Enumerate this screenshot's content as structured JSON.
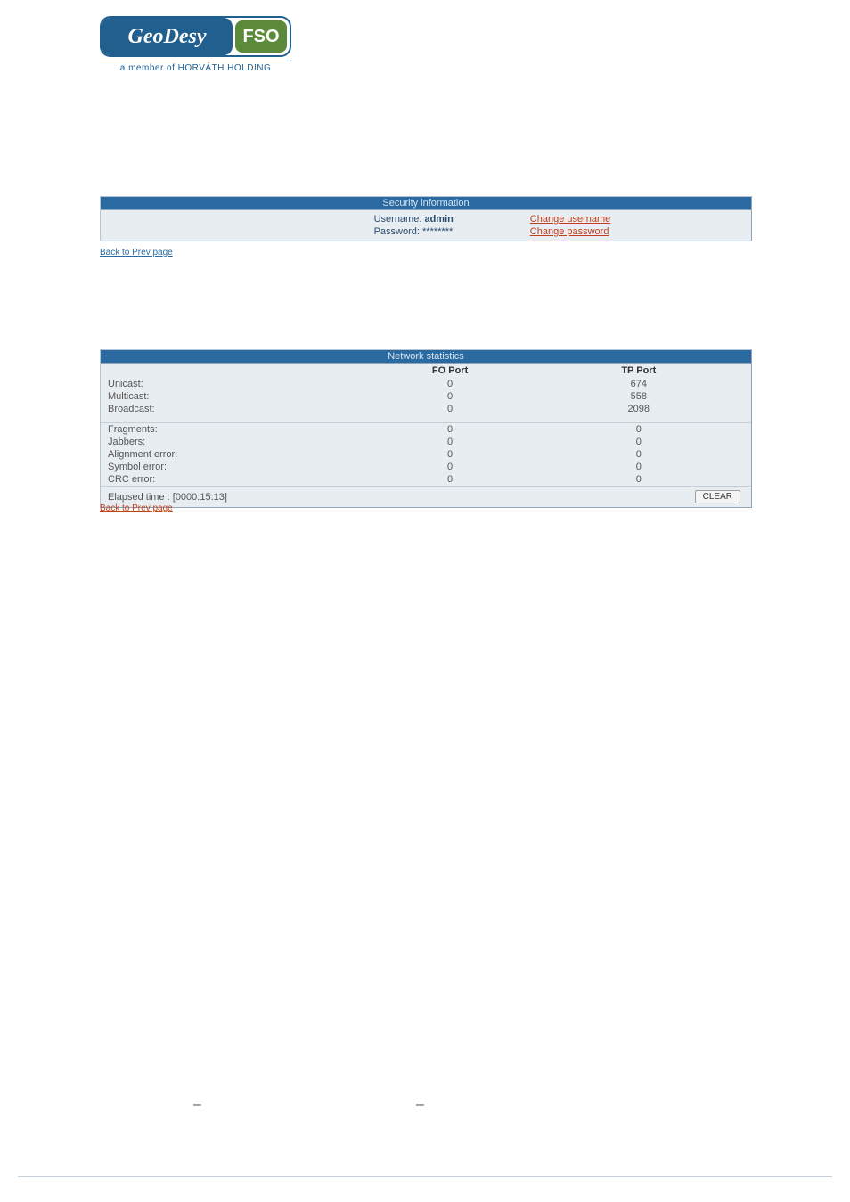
{
  "logo": {
    "main": "GeoDesy",
    "badge": "FSO",
    "sub": "a member of HORVÁTH HOLDING"
  },
  "security_panel": {
    "title": "Security information",
    "username_label": "Username:",
    "username_value": "admin",
    "password_label": "Password:",
    "password_value": "********",
    "change_username": "Change username",
    "change_password": "Change password"
  },
  "back_link": "Back to Prev page",
  "network_panel": {
    "title": "Network statistics",
    "col_fo": "FO Port",
    "col_tp": "TP Port",
    "rows_top": [
      {
        "label": "Unicast:",
        "fo": "0",
        "tp": "674"
      },
      {
        "label": "Multicast:",
        "fo": "0",
        "tp": "558"
      },
      {
        "label": "Broadcast:",
        "fo": "0",
        "tp": "2098"
      }
    ],
    "rows_bottom": [
      {
        "label": "Fragments:",
        "fo": "0",
        "tp": "0"
      },
      {
        "label": "Jabbers:",
        "fo": "0",
        "tp": "0"
      },
      {
        "label": "Alignment error:",
        "fo": "0",
        "tp": "0"
      },
      {
        "label": "Symbol error:",
        "fo": "0",
        "tp": "0"
      },
      {
        "label": "CRC error:",
        "fo": "0",
        "tp": "0"
      }
    ],
    "elapsed": "Elapsed time : [0000:15:13]",
    "clear_label": "CLEAR"
  },
  "dashes": {
    "d1": "–",
    "d2": "–"
  }
}
